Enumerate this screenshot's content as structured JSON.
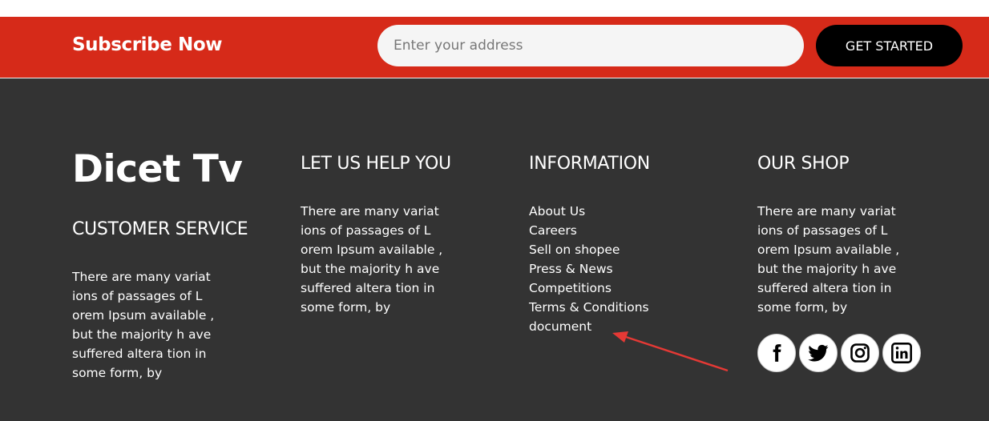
{
  "subscribe": {
    "title": "Subscribe Now",
    "input_placeholder": "Enter your address",
    "button_label": "GET STARTED",
    "bar_color": "#d62a19"
  },
  "footer": {
    "background": "#333333",
    "brand": "Dicet Tv",
    "customer_service": {
      "heading": "CUSTOMER SERVICE",
      "lines": [
        "There are many variat",
        "ions of passages of L",
        "orem Ipsum available ,",
        "but the majority h ave",
        "suffered altera tion in",
        "some form, by"
      ]
    },
    "help": {
      "heading": "LET US HELP YOU",
      "lines": [
        "There are many variat",
        "ions of passages of L",
        "orem Ipsum available ,",
        "but the majority h ave",
        "suffered altera tion in",
        "some form, by"
      ]
    },
    "information": {
      "heading": "INFORMATION",
      "links": [
        "About Us",
        "Careers",
        "Sell on shopee",
        "Press & News",
        "Competitions",
        "Terms & Conditions",
        "document"
      ]
    },
    "shop": {
      "heading": "OUR SHOP",
      "lines": [
        "There are many variat",
        "ions of passages of L",
        "orem Ipsum available ,",
        "but the majority h ave",
        "suffered altera tion in",
        "some form, by"
      ]
    },
    "social": [
      "facebook-icon",
      "twitter-icon",
      "instagram-icon",
      "linkedin-icon"
    ]
  },
  "annotation": {
    "arrow_color": "#e53935"
  }
}
